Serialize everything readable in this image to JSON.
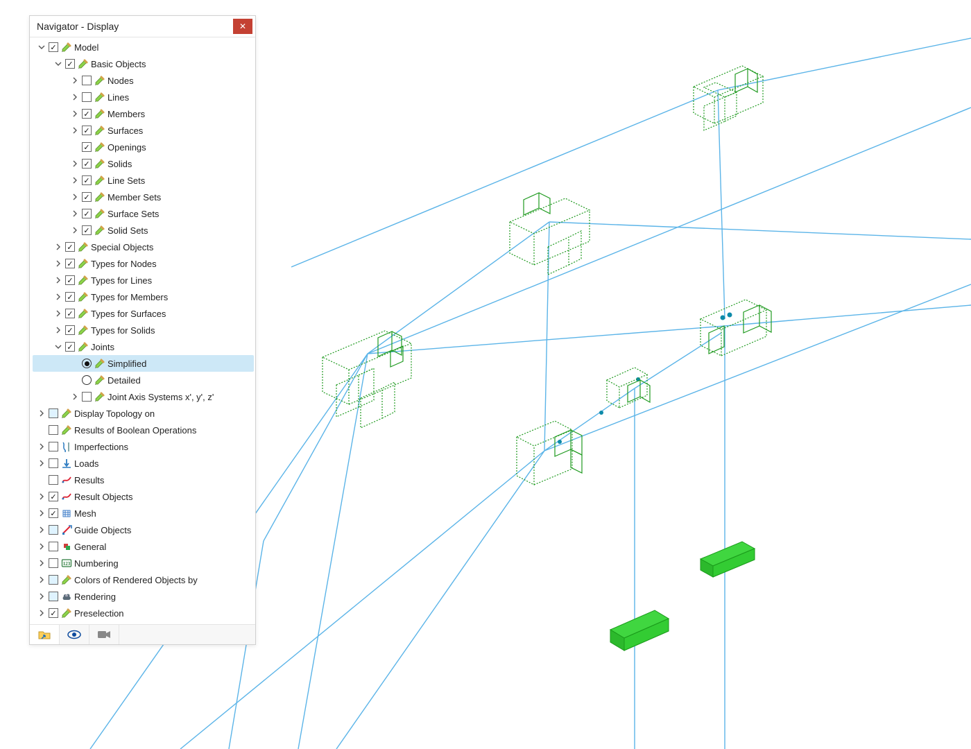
{
  "panel": {
    "title": "Navigator - Display",
    "close_glyph": "✕"
  },
  "tree": {
    "items": [
      {
        "indent": 0,
        "twisty": "down",
        "ctrl": "check",
        "checked": true,
        "icon": "pencil",
        "label": "Model"
      },
      {
        "indent": 1,
        "twisty": "down",
        "ctrl": "check",
        "checked": true,
        "icon": "pencil",
        "label": "Basic Objects"
      },
      {
        "indent": 2,
        "twisty": "right",
        "ctrl": "check",
        "checked": false,
        "icon": "pencil",
        "label": "Nodes"
      },
      {
        "indent": 2,
        "twisty": "right",
        "ctrl": "check",
        "checked": false,
        "icon": "pencil",
        "label": "Lines"
      },
      {
        "indent": 2,
        "twisty": "right",
        "ctrl": "check",
        "checked": true,
        "icon": "pencil",
        "label": "Members"
      },
      {
        "indent": 2,
        "twisty": "right",
        "ctrl": "check",
        "checked": true,
        "icon": "pencil",
        "label": "Surfaces"
      },
      {
        "indent": 2,
        "twisty": "blank",
        "ctrl": "check",
        "checked": true,
        "icon": "pencil",
        "label": "Openings"
      },
      {
        "indent": 2,
        "twisty": "right",
        "ctrl": "check",
        "checked": true,
        "icon": "pencil",
        "label": "Solids"
      },
      {
        "indent": 2,
        "twisty": "right",
        "ctrl": "check",
        "checked": true,
        "icon": "pencil",
        "label": "Line Sets"
      },
      {
        "indent": 2,
        "twisty": "right",
        "ctrl": "check",
        "checked": true,
        "icon": "pencil",
        "label": "Member Sets"
      },
      {
        "indent": 2,
        "twisty": "right",
        "ctrl": "check",
        "checked": true,
        "icon": "pencil",
        "label": "Surface Sets"
      },
      {
        "indent": 2,
        "twisty": "right",
        "ctrl": "check",
        "checked": true,
        "icon": "pencil",
        "label": "Solid Sets"
      },
      {
        "indent": 1,
        "twisty": "right",
        "ctrl": "check",
        "checked": true,
        "icon": "pencil",
        "label": "Special Objects"
      },
      {
        "indent": 1,
        "twisty": "right",
        "ctrl": "check",
        "checked": true,
        "icon": "pencil",
        "label": "Types for Nodes"
      },
      {
        "indent": 1,
        "twisty": "right",
        "ctrl": "check",
        "checked": true,
        "icon": "pencil",
        "label": "Types for Lines"
      },
      {
        "indent": 1,
        "twisty": "right",
        "ctrl": "check",
        "checked": true,
        "icon": "pencil",
        "label": "Types for Members"
      },
      {
        "indent": 1,
        "twisty": "right",
        "ctrl": "check",
        "checked": true,
        "icon": "pencil",
        "label": "Types for Surfaces"
      },
      {
        "indent": 1,
        "twisty": "right",
        "ctrl": "check",
        "checked": true,
        "icon": "pencil",
        "label": "Types for Solids"
      },
      {
        "indent": 1,
        "twisty": "down",
        "ctrl": "check",
        "checked": true,
        "icon": "pencil",
        "label": "Joints"
      },
      {
        "indent": 2,
        "twisty": "blank",
        "ctrl": "radio",
        "checked": true,
        "icon": "pencil",
        "label": "Simplified",
        "selected": true
      },
      {
        "indent": 2,
        "twisty": "blank",
        "ctrl": "radio",
        "checked": false,
        "icon": "pencil",
        "label": "Detailed"
      },
      {
        "indent": 2,
        "twisty": "right",
        "ctrl": "check",
        "checked": false,
        "icon": "pencil",
        "label": "Joint Axis Systems x', y', z'"
      },
      {
        "indent": 0,
        "twisty": "right",
        "ctrl": "bluecheck",
        "checked": false,
        "icon": "pencil",
        "label": "Display Topology on"
      },
      {
        "indent": 0,
        "twisty": "blank",
        "ctrl": "check",
        "checked": false,
        "icon": "pencil",
        "label": "Results of Boolean Operations"
      },
      {
        "indent": 0,
        "twisty": "right",
        "ctrl": "check",
        "checked": false,
        "icon": "imperf",
        "label": "Imperfections"
      },
      {
        "indent": 0,
        "twisty": "right",
        "ctrl": "check",
        "checked": false,
        "icon": "loads",
        "label": "Loads"
      },
      {
        "indent": 0,
        "twisty": "blank",
        "ctrl": "check",
        "checked": false,
        "icon": "results",
        "label": "Results"
      },
      {
        "indent": 0,
        "twisty": "right",
        "ctrl": "check",
        "checked": true,
        "icon": "results",
        "label": "Result Objects"
      },
      {
        "indent": 0,
        "twisty": "right",
        "ctrl": "check",
        "checked": true,
        "icon": "mesh",
        "label": "Mesh"
      },
      {
        "indent": 0,
        "twisty": "right",
        "ctrl": "bluecheck",
        "checked": false,
        "icon": "guide",
        "label": "Guide Objects"
      },
      {
        "indent": 0,
        "twisty": "right",
        "ctrl": "check",
        "checked": false,
        "icon": "general",
        "label": "General"
      },
      {
        "indent": 0,
        "twisty": "right",
        "ctrl": "check",
        "checked": false,
        "icon": "number",
        "label": "Numbering"
      },
      {
        "indent": 0,
        "twisty": "right",
        "ctrl": "bluecheck",
        "checked": false,
        "icon": "pencil",
        "label": "Colors of Rendered Objects by"
      },
      {
        "indent": 0,
        "twisty": "right",
        "ctrl": "bluecheck",
        "checked": false,
        "icon": "render",
        "label": "Rendering"
      },
      {
        "indent": 0,
        "twisty": "right",
        "ctrl": "check",
        "checked": true,
        "icon": "pencil",
        "label": "Preselection"
      }
    ]
  },
  "footer_tabs": [
    "project",
    "eye",
    "camera"
  ],
  "colors": {
    "wire": "#5bb4e8",
    "joint": "#1f9a1f",
    "solid_fill": "#33d233",
    "solid_edge": "#1c9b1c"
  }
}
